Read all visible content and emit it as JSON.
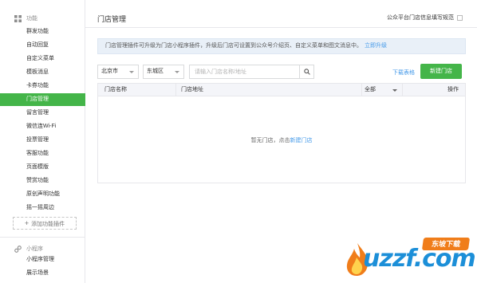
{
  "sidebar": {
    "section_function": {
      "label": "功能",
      "icon": "grid-icon"
    },
    "items": [
      {
        "label": "群发功能"
      },
      {
        "label": "自动回复"
      },
      {
        "label": "自定义菜单"
      },
      {
        "label": "模板消息"
      },
      {
        "label": "卡券功能"
      },
      {
        "label": "门店管理",
        "active": true
      },
      {
        "label": "留言管理"
      },
      {
        "label": "微信连Wi-Fi"
      },
      {
        "label": "投票管理"
      },
      {
        "label": "客服功能"
      },
      {
        "label": "页面模版"
      },
      {
        "label": "赞赏功能"
      },
      {
        "label": "原创声明功能"
      },
      {
        "label": "摇一摇周边"
      }
    ],
    "add_plugin_label": "添加功能插件",
    "section_miniprogram": {
      "label": "小程序",
      "icon": "link-icon"
    },
    "mini_items": [
      {
        "label": "小程序管理"
      },
      {
        "label": "展示场景"
      }
    ]
  },
  "header": {
    "title": "门店管理",
    "guide_label": "公众平台门店信息填写规范"
  },
  "notice": {
    "text": "门店管理插件可升级为门店小程序插件，升级后门店可设置到公众号介绍页、自定义菜单和图文消息中。",
    "link": "立即升级"
  },
  "filters": {
    "city": "北京市",
    "district": "东城区",
    "search_placeholder": "请输入门店名称/地址"
  },
  "actions": {
    "download_label": "下载表格",
    "new_store_label": "新建门店"
  },
  "table": {
    "columns": [
      "门店名称",
      "门店地址",
      "全部",
      "操作"
    ],
    "empty_text": "暂无门店，点击",
    "empty_link": "新建门店"
  },
  "watermark": {
    "brand": "uzzf.com",
    "badge": "东坡下载"
  },
  "colors": {
    "accent_green": "#44b549",
    "link_blue": "#459ae9",
    "notice_bg": "#e9f0f8"
  }
}
